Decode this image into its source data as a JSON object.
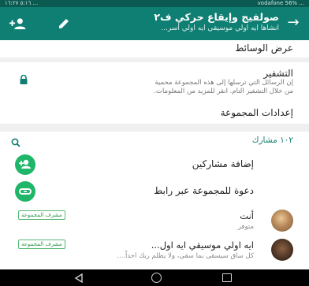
{
  "statusbar": {
    "left": "٥:١٦ ١٦:٢٧ ...",
    "right": "vodafone 56% ..."
  },
  "header": {
    "title": "صولفيج وإيقاع حركي ف٢",
    "subtitle": "انشاها ايه اولي موسيقي ايه اولي أسر..."
  },
  "media": {
    "title": "عرض الوسائط"
  },
  "encryption": {
    "title": "التشفير",
    "desc_line1": "إن الرسائل التي ترسلها إلى هذه المجموعة محمية",
    "desc_line2": "من خلال التشفير التام. انقر للمزيد من المعلومات."
  },
  "group_settings": {
    "title": "إعدادات المجموعة"
  },
  "participants": {
    "count_label": "١٠٢ مشارك"
  },
  "actions": {
    "add_participants": "إضافة مشاركين",
    "invite_link": "دعوة للمجموعة عبر رابط"
  },
  "members": [
    {
      "name": "أنت",
      "status": "متوفر",
      "badge": "مشرف المجموعة"
    },
    {
      "name": "ايه اولي موسيقي ايه اول...",
      "status": "كل ساق سيسقى بما سقى، ولا يظلم ربك احداً....",
      "badge": "مشرف المجموعة"
    }
  ],
  "colors": {
    "primary": "#0f7f73",
    "accent": "#1fb66a",
    "status_bar": "#0b5a52"
  }
}
